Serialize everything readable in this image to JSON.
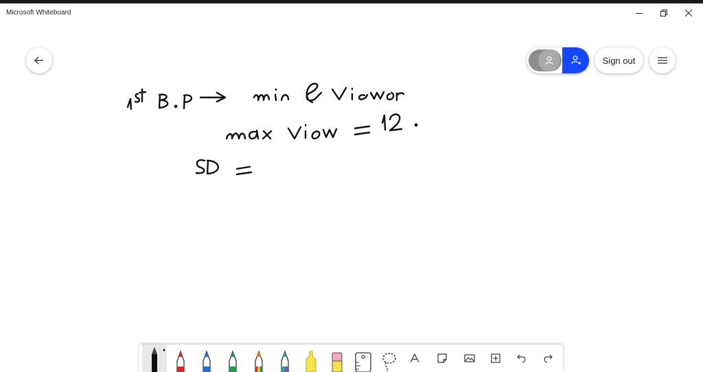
{
  "window": {
    "title": "Microsoft Whiteboard"
  },
  "header": {
    "sign_out_label": "Sign out"
  },
  "canvas": {
    "ink_lines": [
      "1st B.P → min & viewer",
      "max view = 12.",
      "SD ="
    ]
  },
  "toolbar": {
    "tools": [
      {
        "name": "black-pen",
        "color": "#111111"
      },
      {
        "name": "red-pen",
        "color": "#d9262c"
      },
      {
        "name": "blue-pen",
        "color": "#1f6fd1"
      },
      {
        "name": "green-pen",
        "color": "#1e9a4b"
      },
      {
        "name": "rainbow-pen",
        "color": "#e8862a"
      },
      {
        "name": "galaxy-pen",
        "color": "#2fa58f"
      },
      {
        "name": "highlighter",
        "color": "#f4e34a"
      },
      {
        "name": "eraser",
        "color": "#f2a6c4"
      },
      {
        "name": "ruler-icon"
      },
      {
        "name": "lasso-icon"
      },
      {
        "name": "text-icon"
      },
      {
        "name": "note-icon"
      },
      {
        "name": "image-icon"
      },
      {
        "name": "add-icon"
      },
      {
        "name": "undo-icon"
      },
      {
        "name": "redo-icon"
      }
    ]
  },
  "colors": {
    "accent": "#1447ff",
    "ink": "#111111"
  }
}
